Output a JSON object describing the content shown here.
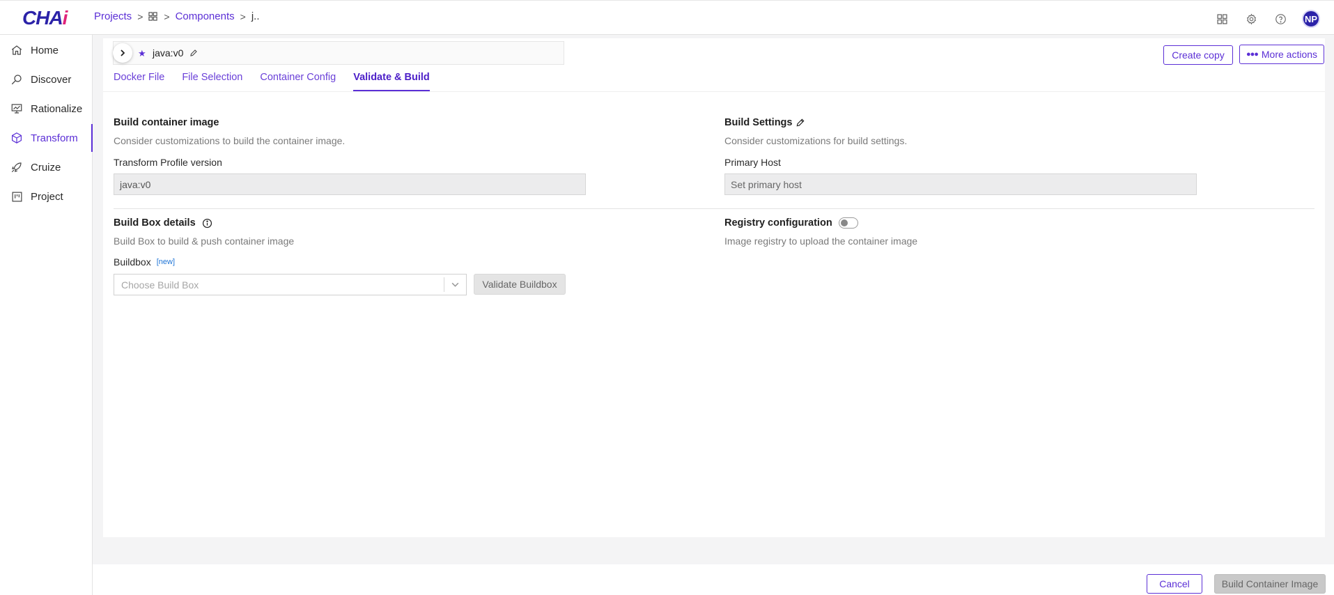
{
  "app": {
    "logo_main": "CHA",
    "logo_accent": "i",
    "user_initials": "NP"
  },
  "breadcrumb": {
    "projects": "Projects",
    "components": "Components",
    "current": "j.."
  },
  "sidebar": {
    "items": [
      {
        "label": "Home",
        "icon": "home-icon"
      },
      {
        "label": "Discover",
        "icon": "discover-icon"
      },
      {
        "label": "Rationalize",
        "icon": "rationalize-icon"
      },
      {
        "label": "Transform",
        "icon": "transform-icon",
        "active": true
      },
      {
        "label": "Cruize",
        "icon": "cruize-icon"
      },
      {
        "label": "Project",
        "icon": "project-icon"
      }
    ]
  },
  "profile": {
    "name": "java:v0"
  },
  "actions": {
    "create_copy": "Create copy",
    "more_actions": "More actions"
  },
  "tabs": [
    {
      "label": "Docker File"
    },
    {
      "label": "File Selection"
    },
    {
      "label": "Container Config"
    },
    {
      "label": "Validate & Build",
      "active": true
    }
  ],
  "build_image": {
    "title": "Build container image",
    "subtitle": "Consider customizations to build the container image.",
    "field_label": "Transform Profile version",
    "field_value": "java:v0"
  },
  "build_settings": {
    "title": "Build Settings",
    "subtitle": "Consider customizations for build settings.",
    "field_label": "Primary Host",
    "field_placeholder": "Set primary host"
  },
  "build_box": {
    "title": "Build Box details",
    "subtitle": "Build Box to build & push container image",
    "field_label": "Buildbox",
    "new_tag": "[new]",
    "select_placeholder": "Choose Build Box",
    "validate_label": "Validate Buildbox"
  },
  "registry": {
    "title": "Registry configuration",
    "subtitle": "Image registry to upload the container image",
    "enabled": false
  },
  "footer": {
    "cancel": "Cancel",
    "build": "Build Container Image"
  },
  "colors": {
    "accent": "#5b2fd6",
    "brand": "#2b22a8",
    "logo_pink": "#e0237a"
  }
}
